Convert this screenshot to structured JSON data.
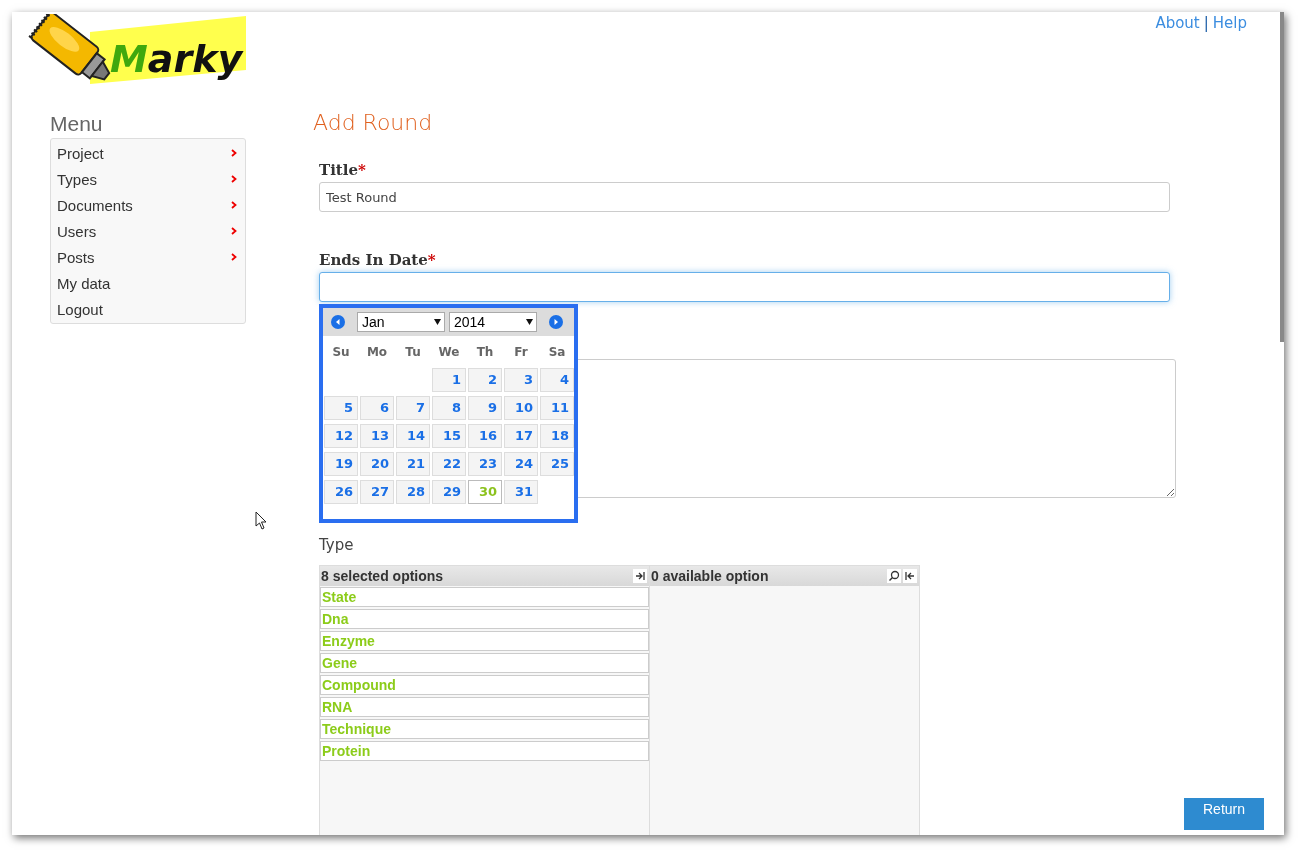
{
  "logo": {
    "text": "Marky"
  },
  "header_links": [
    {
      "label": "About"
    },
    {
      "label": "Help"
    }
  ],
  "header_separator": "|",
  "menu": {
    "title": "Menu",
    "items": [
      {
        "label": "Project",
        "has_submenu": true
      },
      {
        "label": "Types",
        "has_submenu": true
      },
      {
        "label": "Documents",
        "has_submenu": true
      },
      {
        "label": "Users",
        "has_submenu": true
      },
      {
        "label": "Posts",
        "has_submenu": true
      },
      {
        "label": "My data",
        "has_submenu": false
      },
      {
        "label": "Logout",
        "has_submenu": false
      }
    ]
  },
  "form": {
    "title": "Add Round",
    "fields": [
      {
        "kind": "text",
        "label": "Title",
        "required_mark": "*",
        "value": "Test Round",
        "focused": false
      },
      {
        "kind": "date",
        "label": "Ends In Date",
        "required_mark": "*",
        "focused": true
      },
      {
        "kind": "textarea"
      }
    ]
  },
  "datepicker": {
    "month": "Jan",
    "year": "2014",
    "weekdays": [
      "Su",
      "Mo",
      "Tu",
      "We",
      "Th",
      "Fr",
      "Sa"
    ],
    "weeks": [
      [
        {
          "kind": "blank"
        },
        {
          "kind": "blank"
        },
        {
          "kind": "blank"
        },
        {
          "day": "1",
          "today": false
        },
        {
          "day": "2",
          "today": false
        },
        {
          "day": "3",
          "today": false
        },
        {
          "day": "4",
          "today": false
        }
      ],
      [
        {
          "day": "5",
          "today": false
        },
        {
          "day": "6",
          "today": false
        },
        {
          "day": "7",
          "today": false
        },
        {
          "day": "8",
          "today": false
        },
        {
          "day": "9",
          "today": false
        },
        {
          "day": "10",
          "today": false
        },
        {
          "day": "11",
          "today": false
        }
      ],
      [
        {
          "day": "12",
          "today": false
        },
        {
          "day": "13",
          "today": false
        },
        {
          "day": "14",
          "today": false
        },
        {
          "day": "15",
          "today": false
        },
        {
          "day": "16",
          "today": false
        },
        {
          "day": "17",
          "today": false
        },
        {
          "day": "18",
          "today": false
        }
      ],
      [
        {
          "day": "19",
          "today": false
        },
        {
          "day": "20",
          "today": false
        },
        {
          "day": "21",
          "today": false
        },
        {
          "day": "22",
          "today": false
        },
        {
          "day": "23",
          "today": false
        },
        {
          "day": "24",
          "today": false
        },
        {
          "day": "25",
          "today": false
        }
      ],
      [
        {
          "day": "26",
          "today": false
        },
        {
          "day": "27",
          "today": false
        },
        {
          "day": "28",
          "today": false
        },
        {
          "day": "29",
          "today": false
        },
        {
          "day": "30",
          "today": true
        },
        {
          "day": "31",
          "today": false
        },
        {
          "kind": "blank"
        }
      ]
    ]
  },
  "type_select": {
    "label": "Type",
    "selected_header": "8 selected options",
    "available_header": "0 available option",
    "selected_items": [
      "State",
      "Dna",
      "Enzyme",
      "Gene",
      "Compound",
      "RNA",
      "Technique",
      "Protein"
    ]
  },
  "return_button": {
    "label": "Return"
  }
}
